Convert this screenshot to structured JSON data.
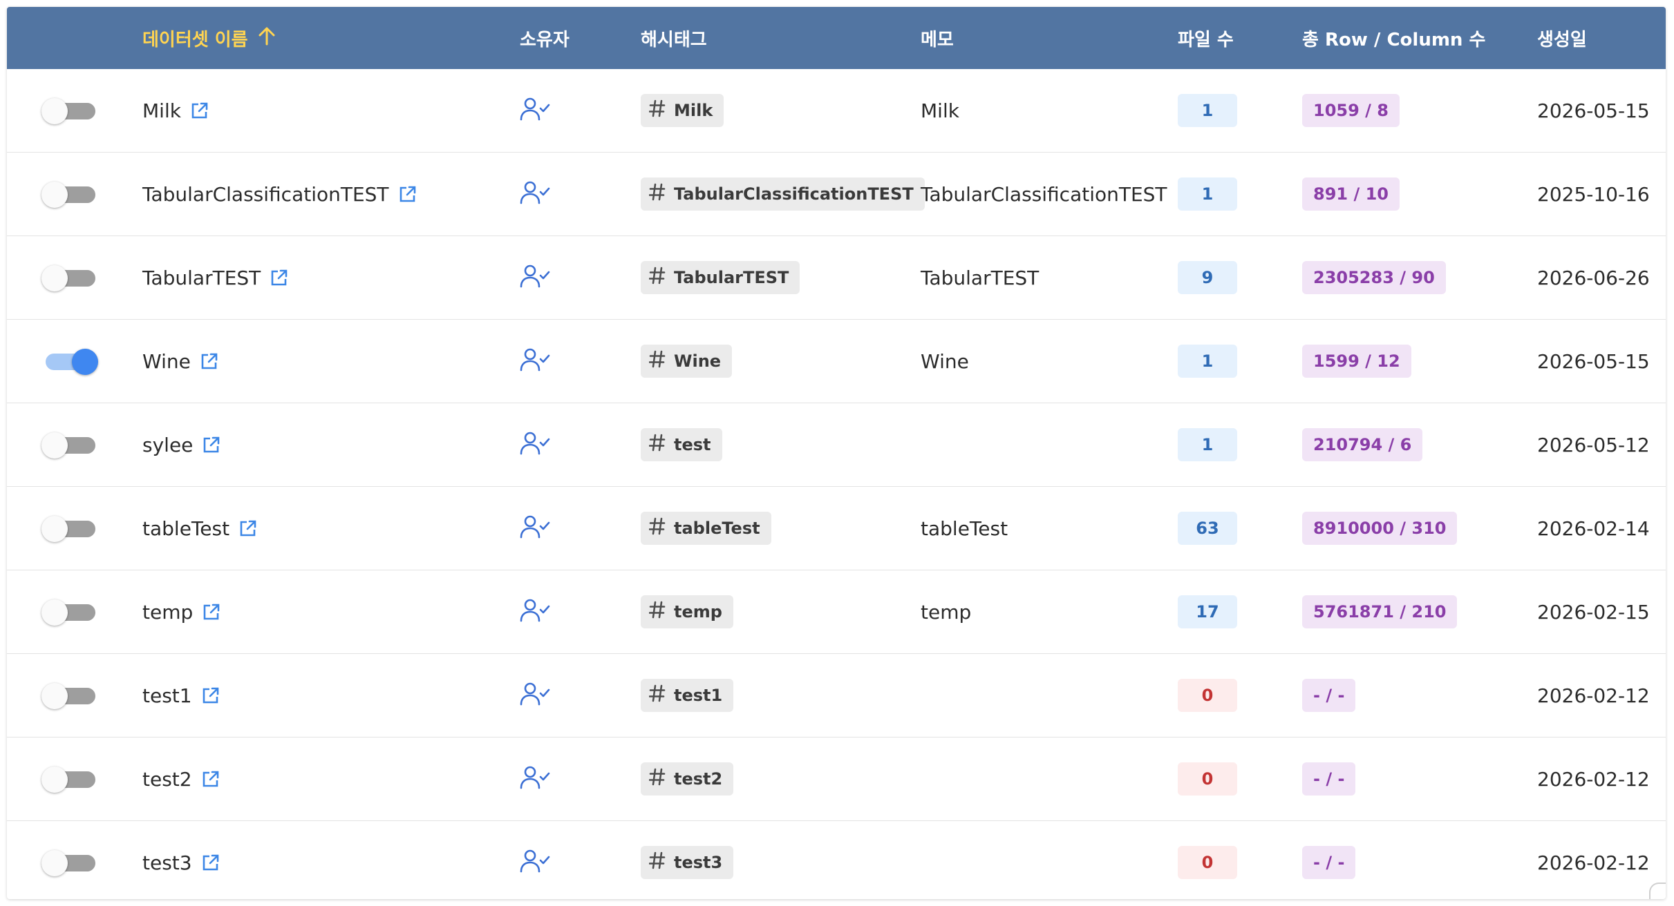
{
  "header": {
    "name": "데이터셋 이름",
    "sort_icon": "arrow-up-icon",
    "owner": "소유자",
    "hashtag": "해시태그",
    "memo": "메모",
    "files": "파일 수",
    "rowcol": "총 Row / Column 수",
    "created": "생성일"
  },
  "colors": {
    "header_bg": "#5275a2",
    "sorted_header": "#ffd451",
    "accent": "#3f87f0"
  },
  "rows": [
    {
      "enabled": false,
      "name": "Milk",
      "tag": "Milk",
      "memo": "Milk",
      "files": "1",
      "rowcol": "1059 / 8",
      "date": "2026-05-15"
    },
    {
      "enabled": false,
      "name": "TabularClassificationTEST",
      "tag": "TabularClassificationTEST",
      "memo": "TabularClassificationTEST",
      "files": "1",
      "rowcol": "891 / 10",
      "date": "2025-10-16"
    },
    {
      "enabled": false,
      "name": "TabularTEST",
      "tag": "TabularTEST",
      "memo": "TabularTEST",
      "files": "9",
      "rowcol": "2305283 / 90",
      "date": "2026-06-26"
    },
    {
      "enabled": true,
      "name": "Wine",
      "tag": "Wine",
      "memo": "Wine",
      "files": "1",
      "rowcol": "1599 / 12",
      "date": "2026-05-15"
    },
    {
      "enabled": false,
      "name": "sylee",
      "tag": "test",
      "memo": "",
      "files": "1",
      "rowcol": "210794 / 6",
      "date": "2026-05-12"
    },
    {
      "enabled": false,
      "name": "tableTest",
      "tag": "tableTest",
      "memo": "tableTest",
      "files": "63",
      "rowcol": "8910000 / 310",
      "date": "2026-02-14"
    },
    {
      "enabled": false,
      "name": "temp",
      "tag": "temp",
      "memo": "temp",
      "files": "17",
      "rowcol": "5761871 / 210",
      "date": "2026-02-15"
    },
    {
      "enabled": false,
      "name": "test1",
      "tag": "test1",
      "memo": "",
      "files": "0",
      "rowcol": "- / -",
      "date": "2026-02-12"
    },
    {
      "enabled": false,
      "name": "test2",
      "tag": "test2",
      "memo": "",
      "files": "0",
      "rowcol": "- / -",
      "date": "2026-02-12"
    },
    {
      "enabled": false,
      "name": "test3",
      "tag": "test3",
      "memo": "",
      "files": "0",
      "rowcol": "- / -",
      "date": "2026-02-12"
    }
  ],
  "icons": {
    "open": "external-link-icon",
    "owner": "user-check-icon",
    "hash": "hash-icon"
  }
}
